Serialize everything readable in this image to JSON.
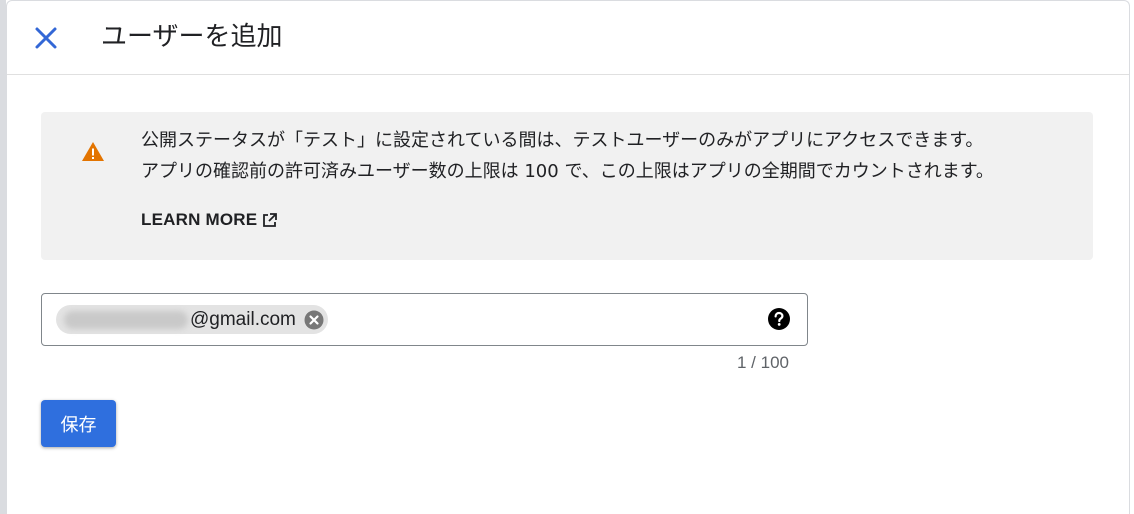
{
  "dialog": {
    "title": "ユーザーを追加",
    "close_icon": "close-icon"
  },
  "notice": {
    "icon": "warning-icon",
    "line1": "公開ステータスが「テスト」に設定されている間は、テストユーザーのみがアプリにアクセスできます。",
    "line2": "アプリの確認前の許可済みユーザー数の上限は 100 で、この上限はアプリの全期間でカウントされます。",
    "learn_more": "LEARN MORE",
    "learn_more_icon": "external-link-icon"
  },
  "user_field": {
    "chip_text": "@gmail.com",
    "chip_remove_icon": "cancel-icon",
    "help_icon": "help-icon",
    "counter": "1 / 100"
  },
  "save_label": "保存",
  "colors": {
    "accent": "#2f6fde",
    "close_icon": "#3367d6",
    "warning": "#e37400",
    "notice_bg": "#f1f1f1"
  }
}
